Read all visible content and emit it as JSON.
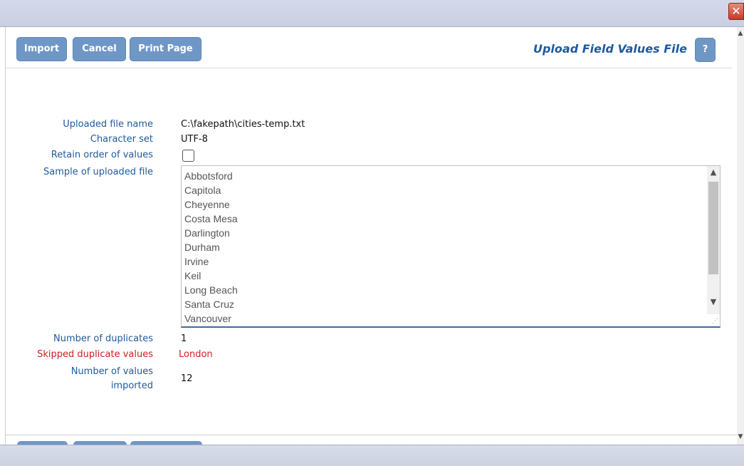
{
  "toolbar": {
    "import_label": "Import",
    "cancel_label": "Cancel",
    "print_label": "Print Page",
    "title": "Upload Field Values File",
    "help_label": "?"
  },
  "window": {
    "close_glyph": "✕"
  },
  "form": {
    "file_name_label": "Uploaded file name",
    "file_name_value": "C:\\fakepath\\cities-temp.txt",
    "charset_label": "Character set",
    "charset_value": "UTF-8",
    "retain_order_label": "Retain order of values",
    "retain_order_checked": false,
    "sample_label": "Sample of uploaded file",
    "sample_lines": [
      "Abbotsford",
      "Capitola",
      "Cheyenne",
      "Costa Mesa",
      "Darlington",
      "Durham",
      "Irvine",
      "Keil",
      "Long Beach",
      "Santa Cruz",
      "Vancouver"
    ],
    "duplicates_label": "Number of duplicates",
    "duplicates_value": "1",
    "skipped_label": "Skipped duplicate values",
    "skipped_value": "London",
    "imported_label_line1": "Number of values",
    "imported_label_line2": "imported",
    "imported_value": "12"
  },
  "colors": {
    "accent": "#6f97c6",
    "label_blue": "#1f5a9c",
    "error_red": "#cc1f1f"
  },
  "icons": {
    "close": "close-icon",
    "scroll_up": "chevron-up-icon",
    "scroll_down": "chevron-down-icon"
  }
}
